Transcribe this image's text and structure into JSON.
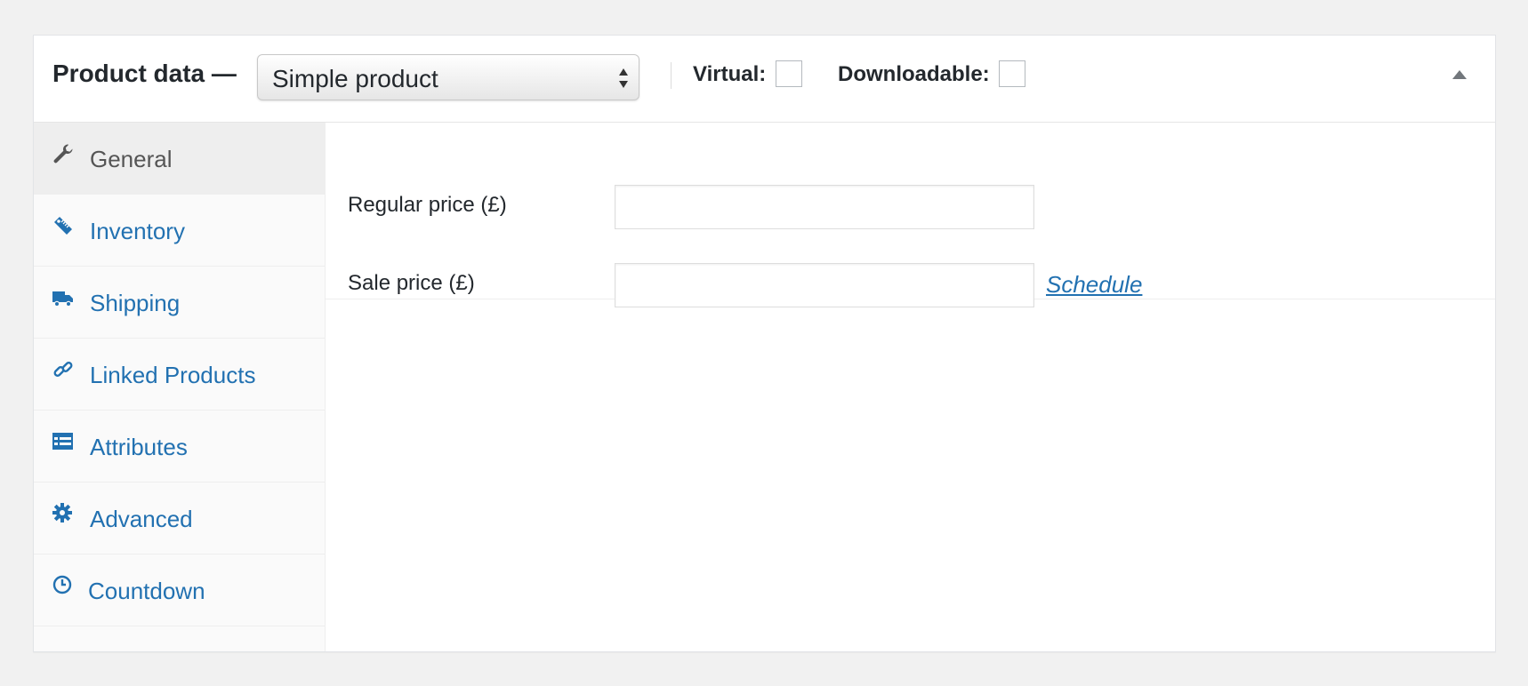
{
  "header": {
    "title": "Product data —",
    "product_type": {
      "selected": "Simple product"
    },
    "virtual_label": "Virtual:",
    "downloadable_label": "Downloadable:"
  },
  "tabs": [
    {
      "label": "General",
      "icon": "wrench-icon",
      "active": true
    },
    {
      "label": "Inventory",
      "icon": "tag-icon",
      "active": false
    },
    {
      "label": "Shipping",
      "icon": "truck-icon",
      "active": false
    },
    {
      "label": "Linked Products",
      "icon": "link-icon",
      "active": false
    },
    {
      "label": "Attributes",
      "icon": "list-icon",
      "active": false
    },
    {
      "label": "Advanced",
      "icon": "gear-icon",
      "active": false
    },
    {
      "label": "Countdown",
      "icon": "clock-icon",
      "active": false
    }
  ],
  "general": {
    "regular_price_label": "Regular price (£)",
    "regular_price_value": "",
    "sale_price_label": "Sale price (£)",
    "sale_price_value": "",
    "schedule_link": "Schedule"
  },
  "colors": {
    "link": "#2271b1",
    "active_tab_bg": "#eeeeee",
    "tab_bg": "#fafafa",
    "page_bg": "#f1f1f1"
  }
}
